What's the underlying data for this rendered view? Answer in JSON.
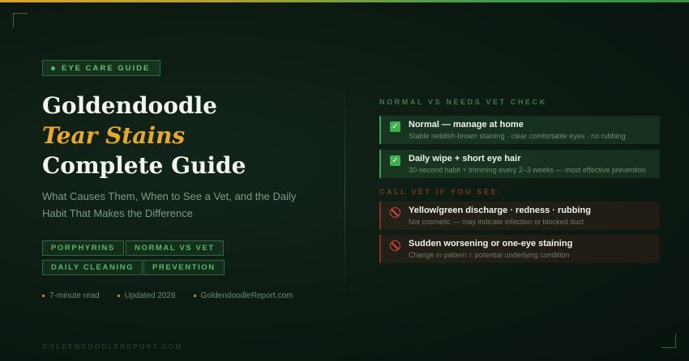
{
  "badge": {
    "label": "EYE CARE GUIDE"
  },
  "title": {
    "line1": "Goldendoodle",
    "line2": "Tear Stains",
    "line3": "Complete Guide"
  },
  "subtitle": "What Causes Them, When to See a Vet, and the Daily Habit That Makes the Difference",
  "tags": [
    "PORPHYRINS",
    "NORMAL VS VET",
    "DAILY CLEANING",
    "PREVENTION"
  ],
  "meta": [
    "7-minute read",
    "Updated 2026",
    "GoldendoodleReport.com"
  ],
  "footer": "GOLDENDOODLEREPORT.COM",
  "section_normal": {
    "label": "NORMAL VS NEEDS VET CHECK",
    "color": "#3f7a4a",
    "cards": [
      {
        "icon": "check-icon",
        "title": "Normal — manage at home",
        "desc": "Stable reddish-brown staining · clear comfortable eyes · no rubbing"
      },
      {
        "icon": "check-icon",
        "title": "Daily wipe + short eye hair",
        "desc": "30-second habit + trimming every 2–3 weeks — most effective prevention"
      }
    ]
  },
  "section_vet": {
    "label": "CALL VET IF YOU SEE:",
    "color": "#7a3526",
    "cards": [
      {
        "icon": "prohibit-icon",
        "title": "Yellow/green discharge · redness · rubbing",
        "desc": "Not cosmetic — may indicate infection or blocked duct"
      },
      {
        "icon": "prohibit-icon",
        "title": "Sudden worsening or one-eye staining",
        "desc": "Change in pattern = potential underlying condition"
      }
    ]
  },
  "colors": {
    "accent": "#e8a82a",
    "green": "#3f9e4d",
    "warning": "#d9483a"
  }
}
